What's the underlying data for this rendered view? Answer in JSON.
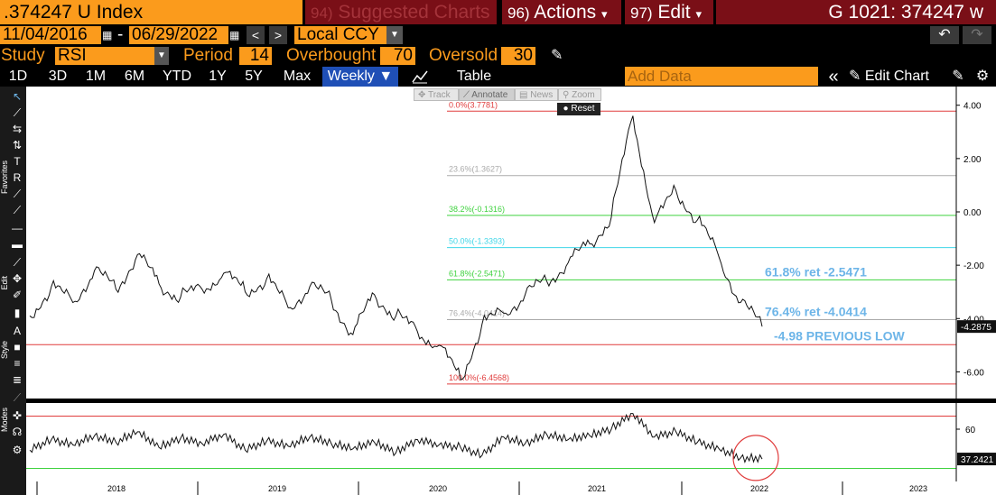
{
  "header": {
    "ticker": ".374247 U Index",
    "suggested": {
      "num": "94)",
      "label": "Suggested Charts"
    },
    "actions": {
      "num": "96)",
      "label": "Actions",
      "caret": "▾"
    },
    "edit": {
      "num": "97)",
      "label": "Edit",
      "caret": "▾"
    },
    "gid": "G 1021: 374247 w"
  },
  "daterow": {
    "start_date": "11/04/2016",
    "dash": "-",
    "end_date": "06/29/2022",
    "currency": "Local CCY",
    "prev": "<",
    "next": ">",
    "undo": "↶",
    "redo": "↷"
  },
  "studyrow": {
    "study_label": "Study",
    "study_value": "RSI",
    "period_label": "Period",
    "period_value": "14",
    "overbought_label": "Overbought",
    "overbought_value": "70",
    "oversold_label": "Oversold",
    "oversold_value": "30"
  },
  "rangebar": {
    "ranges": [
      "1D",
      "3D",
      "1M",
      "6M",
      "YTD",
      "1Y",
      "5Y",
      "Max"
    ],
    "frequency": "Weekly ▼",
    "table": "Table",
    "add_data_placeholder": "Add Data",
    "collapse": "«",
    "edit_chart": "Edit Chart"
  },
  "toolbar": {
    "track": "Track",
    "annotate": "Annotate",
    "news": "News",
    "zoom": "Zoom",
    "reset": "Reset"
  },
  "sidebar": {
    "labels": [
      "Favorites",
      "Edit",
      "Style",
      "Modes"
    ]
  },
  "colors": {
    "accent_orange": "#fb9b1c",
    "header_red": "#7a0f17",
    "selected_blue": "#1f4fb6",
    "annotation_blue": "#6db5e8",
    "fib_red": "#e03c3c",
    "fib_green": "#3fd23f",
    "fib_cyan": "#3fd6e8",
    "fib_gray": "#aaaaaa"
  },
  "chart_data": [
    {
      "type": "line",
      "series": [
        {
          "x": [
            "2016-11",
            "2017-01",
            "2017-03",
            "2017-05",
            "2017-07",
            "2017-09",
            "2017-11",
            "2018-01",
            "2018-03",
            "2018-05",
            "2018-07",
            "2018-09",
            "2018-11",
            "2019-01",
            "2019-03",
            "2019-05",
            "2019-07",
            "2019-09",
            "2019-11",
            "2020-01",
            "2020-03",
            "2020-05",
            "2020-07",
            "2020-09",
            "2020-11",
            "2021-01",
            "2021-03",
            "2021-05",
            "2021-06",
            "2021-08",
            "2021-10",
            "2021-12",
            "2022-02",
            "2022-04",
            "2022-06"
          ],
          "values": [
            -3.9,
            -2.8,
            -3.4,
            -2.2,
            -2.9,
            -1.6,
            -2.7,
            -3.2,
            -2.9,
            -2.3,
            -3.0,
            -2.5,
            -3.6,
            -2.8,
            -3.3,
            -4.6,
            -3.1,
            -3.9,
            -4.5,
            -5.0,
            -6.3,
            -4.2,
            -3.8,
            -3.1,
            -2.6,
            -1.9,
            -1.2,
            -0.2,
            3.6,
            -0.4,
            0.8,
            -0.3,
            -1.7,
            -3.4,
            -4.3
          ]
        }
      ],
      "fibonacci_levels": [
        {
          "label": "0.0%(3.7781)",
          "value": 3.7781,
          "color": "#e03c3c"
        },
        {
          "label": "23.6%(1.3627)",
          "value": 1.3627,
          "color": "#aaaaaa"
        },
        {
          "label": "38.2%(-0.1316)",
          "value": -0.1316,
          "color": "#3fd23f"
        },
        {
          "label": "50.0%(-1.3393)",
          "value": -1.3393,
          "color": "#3fd6e8"
        },
        {
          "label": "61.8%(-2.5471)",
          "value": -2.5471,
          "color": "#3fd23f"
        },
        {
          "label": "76.4%(-4.0414)",
          "value": -4.0414,
          "color": "#aaaaaa"
        },
        {
          "label": "100.0%(-6.4568)",
          "value": -6.4568,
          "color": "#e03c3c"
        }
      ],
      "reference_lines": [
        {
          "value": -4.98,
          "color": "#e03c3c"
        }
      ],
      "annotations": [
        "61.8% ret -2.5471",
        "76.4% ret -4.0414",
        "-4.98 PREVIOUS LOW"
      ],
      "yticks": [
        "4.00",
        "2.00",
        "0.00",
        "-2.00",
        "-4.00",
        "-6.00"
      ],
      "ylim": [
        -7.0,
        4.7
      ],
      "last_value": "-4.2875"
    },
    {
      "type": "line",
      "series": [
        {
          "values": [
            44,
            52,
            48,
            55,
            50,
            58,
            46,
            53,
            49,
            56,
            44,
            51,
            47,
            54,
            49,
            45,
            50,
            42,
            52,
            48,
            46,
            40,
            54,
            49,
            56,
            52,
            55,
            60,
            72,
            54,
            58,
            50,
            45,
            38,
            37.2
          ]
        }
      ],
      "overbought": 70,
      "oversold": 30,
      "yticks": [
        "60"
      ],
      "last_value": "37.2421"
    }
  ],
  "xaxis": {
    "labels": [
      "2018",
      "2019",
      "2020",
      "2021",
      "2022",
      "2023"
    ]
  }
}
